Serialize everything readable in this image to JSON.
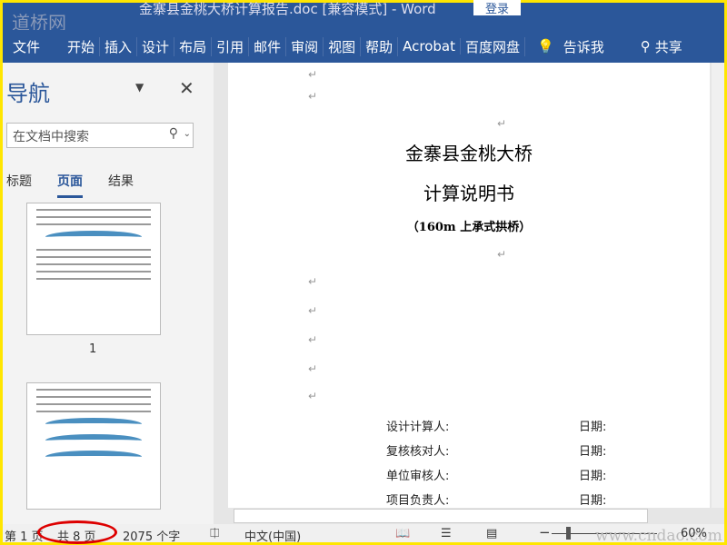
{
  "titlebar": {
    "title": "金寨县金桃大桥计算报告.doc [兼容模式]  -  Word",
    "login": "登录",
    "logo": "道桥网"
  },
  "ribbon": [
    "文件",
    "开始",
    "插入",
    "设计",
    "布局",
    "引用",
    "邮件",
    "审阅",
    "视图",
    "帮助",
    "Acrobat",
    "百度网盘"
  ],
  "tell_me": "告诉我",
  "share": "共享",
  "nav": {
    "title": "导航",
    "search_placeholder": "在文档中搜索",
    "tabs": [
      "标题",
      "页面",
      "结果"
    ],
    "active_tab": "页面",
    "page1_label": "1"
  },
  "doc": {
    "title1": "金寨县金桃大桥",
    "title2": "计算说明书",
    "subtitle": "（160m 上承式拱桥）",
    "signatures": [
      {
        "role": "设计计算人:",
        "date": "日期:"
      },
      {
        "role": "复核核对人:",
        "date": "日期:"
      },
      {
        "role": "单位审核人:",
        "date": "日期:"
      },
      {
        "role": "项目负责人:",
        "date": "日期:"
      }
    ]
  },
  "status": {
    "page": "第 1 页",
    "total": "共 8 页",
    "words": "2075 个字",
    "lang": "中文(中国)",
    "zoom": "60%",
    "zoom_percent": 60,
    "watermark": "www.cndao.com"
  },
  "colors": {
    "accent": "#2b579a",
    "annotation": "#dd0000"
  }
}
